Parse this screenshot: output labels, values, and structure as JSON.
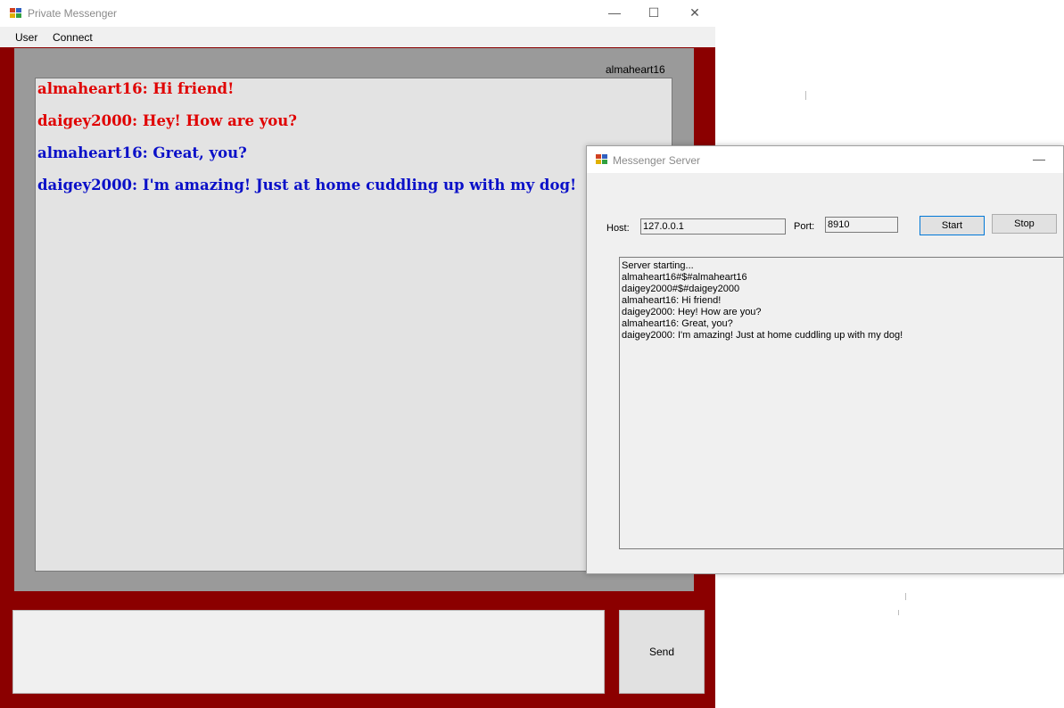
{
  "messenger": {
    "title": "Private Messenger",
    "menu": [
      "User",
      "Connect"
    ],
    "username": "almaheart16",
    "messages": [
      {
        "text": "almaheart16: Hi friend!",
        "color": "#e00000"
      },
      {
        "text": "daigey2000: Hey! How are you?",
        "color": "#e00000"
      },
      {
        "text": "almaheart16: Great, you?",
        "color": "#0a10c8"
      },
      {
        "text": "daigey2000: I'm amazing! Just at home cuddling up with my dog!",
        "color": "#0a10c8"
      }
    ],
    "input_value": "",
    "send_label": "Send",
    "window_buttons": {
      "minimize": "—",
      "maximize": "☐",
      "close": "✕"
    },
    "colors": {
      "frame": "#8b0000",
      "chat_bg": "#e3e3e3",
      "panel": "#9a9a9a"
    }
  },
  "server": {
    "title": "Messenger Server",
    "host_label": "Host:",
    "host_value": "127.0.0.1",
    "port_label": "Port:",
    "port_value": "8910",
    "start_label": "Start",
    "stop_label": "Stop",
    "minimize": "—",
    "log": [
      "Server starting...",
      "almaheart16#$#almaheart16",
      "daigey2000#$#daigey2000",
      "almaheart16: Hi friend!",
      "daigey2000: Hey! How are you?",
      "almaheart16: Great, you?",
      "daigey2000: I'm amazing! Just at home cuddling up with my dog!"
    ]
  }
}
